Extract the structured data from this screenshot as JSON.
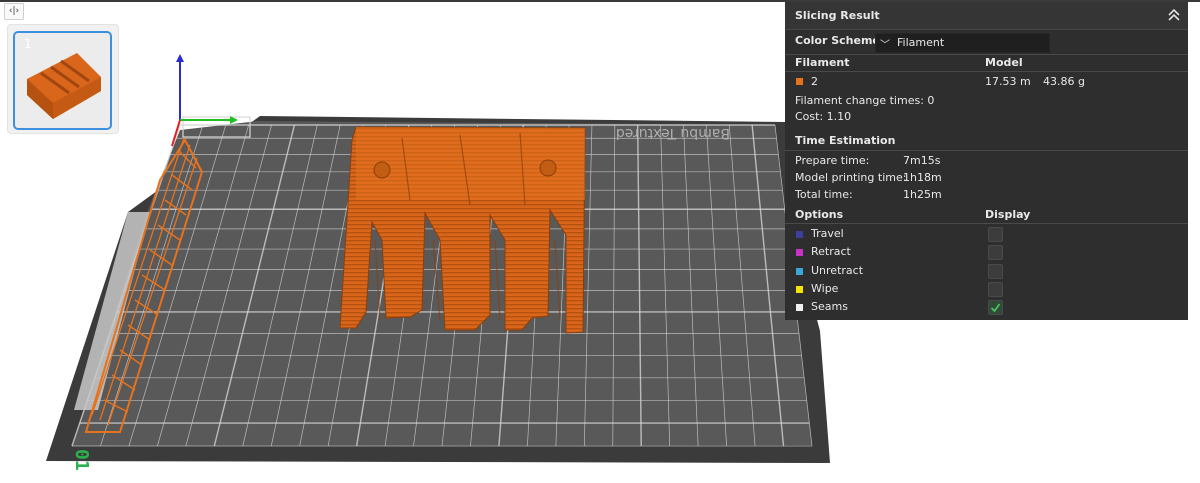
{
  "toolbar": {
    "toggle_label": "‹|›"
  },
  "plate": {
    "number": "1"
  },
  "bed": {
    "brand_text": "Bambu Textured",
    "corner_text": "01"
  },
  "panel": {
    "title": "Slicing Result",
    "color_scheme_label": "Color Scheme",
    "color_scheme_value": "Filament",
    "filament_header": "Filament",
    "model_header": "Model",
    "filament_row": {
      "id": "2",
      "length": "17.53 m",
      "weight": "43.86 g",
      "color": "#e8721c"
    },
    "filament_change": "Filament change times:  0",
    "cost": "Cost:  1.10",
    "time_title": "Time Estimation",
    "prepare_label": "Prepare time:",
    "prepare_value": "7m15s",
    "model_time_label": "Model printing time:",
    "model_time_value": "1h18m",
    "total_label": "Total time:",
    "total_value": "1h25m",
    "options_header": "Options",
    "display_header": "Display",
    "options": [
      {
        "label": "Travel",
        "color": "#3b3f9e",
        "checked": false
      },
      {
        "label": "Retract",
        "color": "#c832c8",
        "checked": false
      },
      {
        "label": "Unretract",
        "color": "#3aa7d6",
        "checked": false
      },
      {
        "label": "Wipe",
        "color": "#f2e600",
        "checked": false
      },
      {
        "label": "Seams",
        "color": "#f0f0f0",
        "checked": true
      }
    ]
  },
  "colors": {
    "accent": "#e8721c",
    "bed": "#5a5a5a",
    "panel": "#2e2e2e",
    "selection": "#3d8fe0"
  }
}
